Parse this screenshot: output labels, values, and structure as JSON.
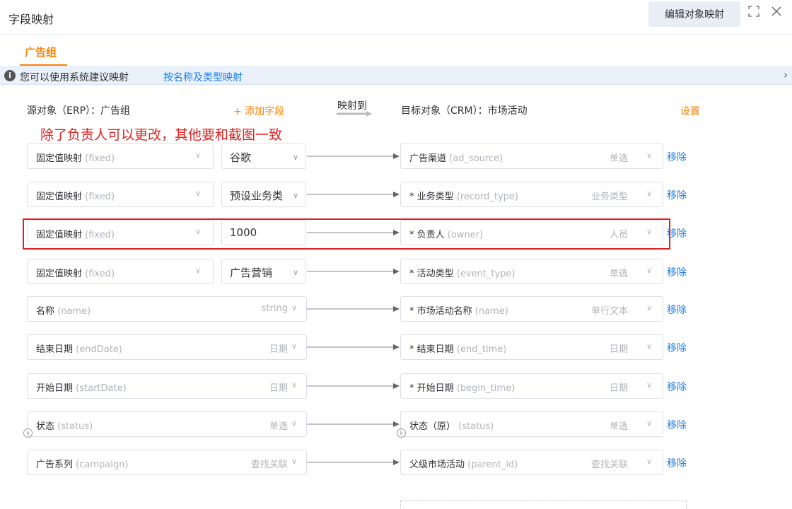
{
  "dialog": {
    "title": "字段映射",
    "edit_button": "编辑对象映射"
  },
  "tabs": [
    {
      "label": "广告组",
      "active": true
    }
  ],
  "notice": {
    "text": "您可以使用系统建议映射",
    "link": "按名称及类型映射"
  },
  "header": {
    "source": "源对象（ERP）：广告组",
    "add_field": "+ 添加字段",
    "map_to": "映射到",
    "target": "目标对象（CRM）：市场活动",
    "settings": "设置"
  },
  "annotation": "除了负责人可以更改，其他要和截图一致",
  "remove_label": "移除",
  "rows": [
    {
      "src_label": "固定值映射",
      "src_api": "(fixed)",
      "src_type": "",
      "value": "谷歌",
      "value_dropdown": true,
      "tgt_label": "广告渠道",
      "tgt_api": "(ad_source)",
      "tgt_type": "单选",
      "required": false
    },
    {
      "src_label": "固定值映射",
      "src_api": "(fixed)",
      "src_type": "",
      "value": "预设业务类",
      "value_dropdown": true,
      "tgt_label": "* 业务类型",
      "tgt_api": "(record_type)",
      "tgt_type": "业务类型",
      "required": true
    },
    {
      "src_label": "固定值映射",
      "src_api": "(fixed)",
      "src_type": "",
      "value": "1000",
      "value_dropdown": false,
      "tgt_label": "* 负责人",
      "tgt_api": "(owner)",
      "tgt_type": "人员",
      "required": true
    },
    {
      "src_label": "固定值映射",
      "src_api": "(fixed)",
      "src_type": "",
      "value": "广告营销",
      "value_dropdown": true,
      "tgt_label": "* 活动类型",
      "tgt_api": "(event_type)",
      "tgt_type": "单选",
      "required": true
    },
    {
      "src_label": "名称",
      "src_api": "(name)",
      "src_type": "string",
      "value": null,
      "tgt_label": "* 市场活动名称",
      "tgt_api": "(name)",
      "tgt_type": "单行文本",
      "required": true
    },
    {
      "src_label": "结束日期",
      "src_api": "(endDate)",
      "src_type": "日期",
      "value": null,
      "tgt_label": "* 结束日期",
      "tgt_api": "(end_time)",
      "tgt_type": "日期",
      "required": true
    },
    {
      "src_label": "开始日期",
      "src_api": "(startDate)",
      "src_type": "日期",
      "value": null,
      "tgt_label": "* 开始日期",
      "tgt_api": "(begin_time)",
      "tgt_type": "日期",
      "required": true
    },
    {
      "src_label": "状态",
      "src_api": "(status)",
      "src_type": "单选",
      "value": null,
      "tgt_label": "状态（原）",
      "tgt_api": "(status)",
      "tgt_type": "单选",
      "required": false,
      "expandable": true
    },
    {
      "src_label": "广告系列",
      "src_api": "(campaign)",
      "src_type": "查找关联",
      "value": null,
      "tgt_label": "父级市场活动",
      "tgt_api": "(parent_id)",
      "tgt_type": "查找关联",
      "required": false
    }
  ],
  "colors": {
    "accent": "#ff8000",
    "link": "#1a7ef2",
    "annotation": "#e02020",
    "notice_bg": "#eaf1fb"
  },
  "icons": {
    "fullscreen": "fullscreen-icon",
    "close": "close-icon",
    "info": "info-icon",
    "chevron": "chevron-down-icon",
    "expand": "expand-circle-icon"
  }
}
